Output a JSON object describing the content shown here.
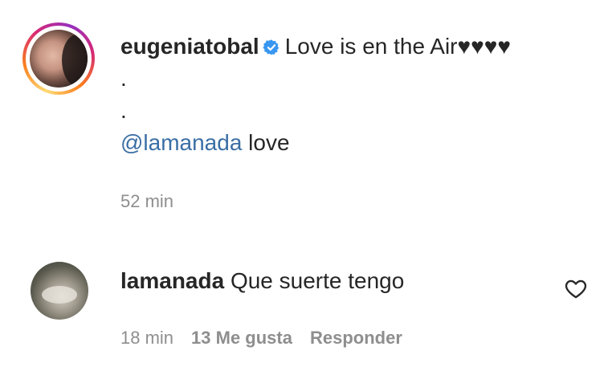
{
  "caption": {
    "username": "eugeniatobal",
    "text": "Love is en the Air♥♥♥♥",
    "dot1": ".",
    "dot2": ".",
    "mention": "@lamanada",
    "mention_suffix": " love",
    "time": "52 min"
  },
  "reply": {
    "username": "lamanada",
    "text": "Que suerte tengo",
    "time": "18 min",
    "likes": "13 Me gusta",
    "reply_label": "Responder"
  },
  "colors": {
    "verified": "#3897f0",
    "mention": "#3a6ea5",
    "meta": "#8e8e8e"
  },
  "icons": {
    "verified": "verified-badge-icon",
    "like": "heart-icon"
  }
}
